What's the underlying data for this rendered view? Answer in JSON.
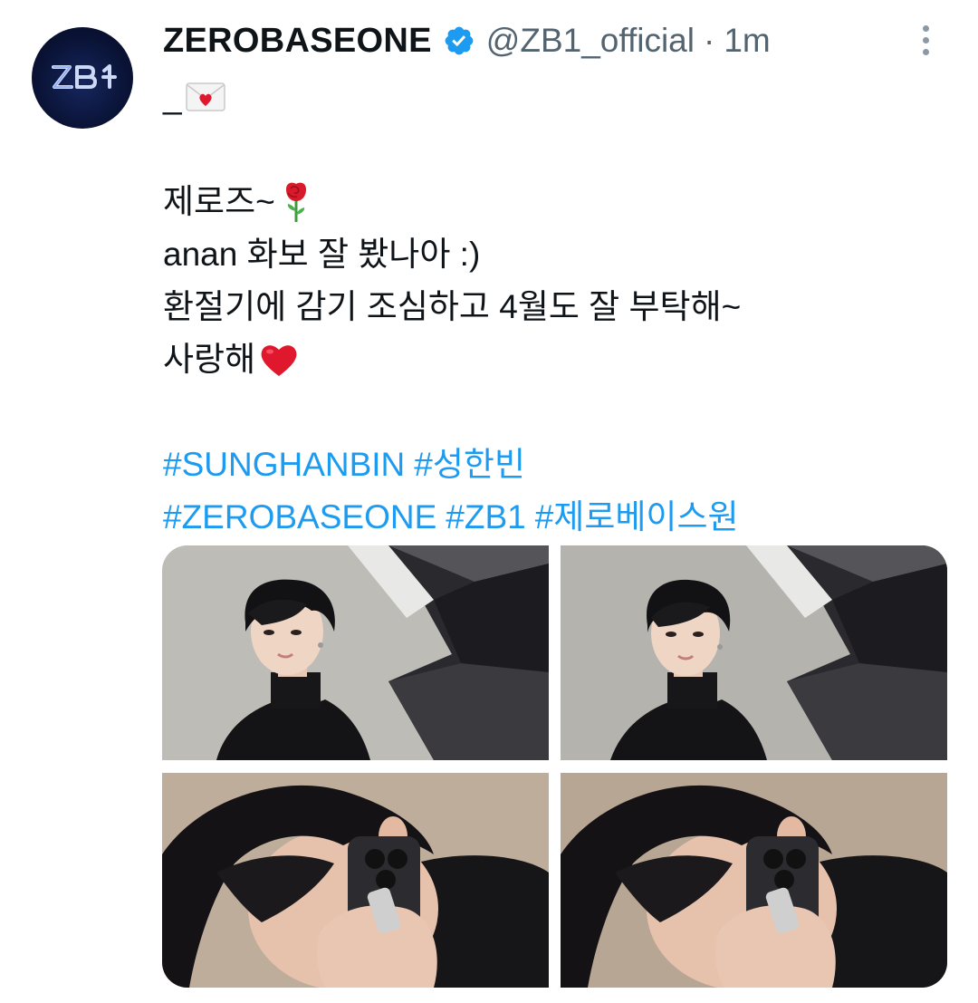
{
  "account": {
    "display_name": "ZEROBASEONE",
    "handle": "@ZB1_official",
    "separator": "·",
    "time": "1m",
    "avatar_text": "ZB1",
    "verified_icon": "verified-badge-icon"
  },
  "tweet": {
    "line1_prefix": "_",
    "line1_emoji": "love-letter-icon",
    "line2": "제로즈~",
    "line2_emoji": "rose-icon",
    "line3": "anan 화보 잘 봤나아 :)",
    "line4": "환절기에 감기 조심하고 4월도 잘 부탁해~",
    "line5": "사랑해",
    "line5_emoji": "red-heart-icon",
    "hashtags_row1": [
      "#SUNGHANBIN",
      "#성한빈"
    ],
    "hashtags_row2": [
      "#ZEROBASEONE",
      "#ZB1",
      "#제로베이스원"
    ]
  },
  "media": [
    {
      "kind": "studio-portrait",
      "description_icon": "photo"
    },
    {
      "kind": "studio-portrait",
      "description_icon": "photo"
    },
    {
      "kind": "mirror-selfie",
      "description_icon": "photo"
    },
    {
      "kind": "mirror-selfie",
      "description_icon": "photo"
    }
  ],
  "colors": {
    "text": "#0f1419",
    "secondary": "#536471",
    "link": "#1d9bf0",
    "verified": "#1d9bf0"
  }
}
